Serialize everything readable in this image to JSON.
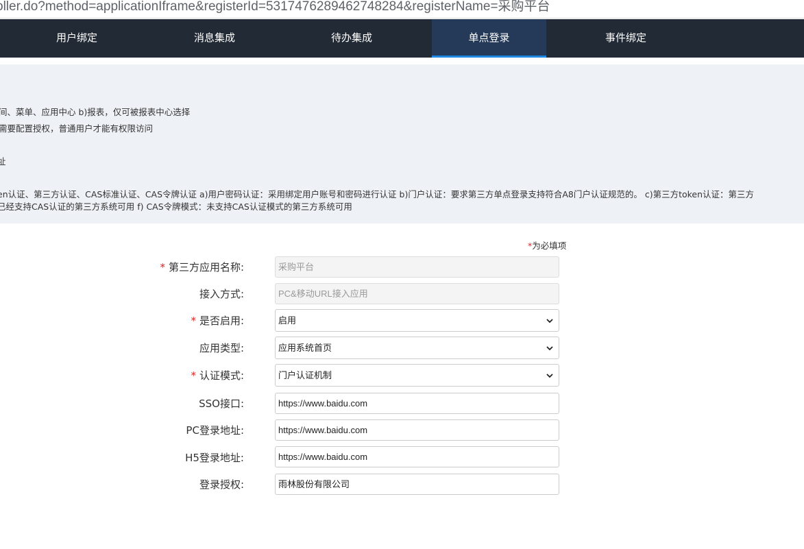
{
  "address_bar": {
    "url": "oller.do?method=applicationIframe&registerId=5317476289462748284&registerName=采购平台"
  },
  "tabs": [
    {
      "label": "用户绑定"
    },
    {
      "label": "消息集成"
    },
    {
      "label": "待办集成"
    },
    {
      "label": "单点登录",
      "active": true
    },
    {
      "label": "事件绑定"
    }
  ],
  "info": {
    "lines": [
      "间、菜单、应用中心 b)报表，仅可被报表中心选择",
      "需要配置授权，普通用户才能有权限访问",
      "址",
      "en认证、第三方认证、CAS标准认证、CAS令牌认证 a)用户密码认证：采用绑定用户账号和密码进行认证 b)门户认证：要求第三方单点登录支持符合A8门户认证规范的。 c)第三方token认证：第三方",
      "已经支持CAS认证的第三方系统可用 f) CAS令牌模式：未支持CAS认证模式的第三方系统可用"
    ]
  },
  "form": {
    "required_note": {
      "star": "*",
      "text": "为必填项"
    },
    "fields": [
      {
        "label": "第三方应用名称:",
        "required": true,
        "value": "采购平台"
      },
      {
        "label": "接入方式:",
        "required": false,
        "value": "PC&移动URL接入应用"
      },
      {
        "label": "是否启用:",
        "required": true,
        "value": "启用"
      },
      {
        "label": "应用类型:",
        "required": false,
        "value": "应用系统首页"
      },
      {
        "label": "认证模式:",
        "required": true,
        "value": "门户认证机制"
      },
      {
        "label": "SSO接口:",
        "required": false,
        "value": "https://www.baidu.com"
      },
      {
        "label": "PC登录地址:",
        "required": false,
        "value": "https://www.baidu.com"
      },
      {
        "label": "H5登录地址:",
        "required": false,
        "value": "https://www.baidu.com"
      },
      {
        "label": "登录授权:",
        "required": false,
        "value": "雨林股份有限公司"
      }
    ]
  },
  "icons": {
    "select_arrow": "chevron-down-icon"
  },
  "colors": {
    "nav_bg": "#222a35",
    "active_tab_bg": "#243a58",
    "active_tab_underline": "#1e88e5",
    "info_bg": "#eef2f6",
    "required_star": "#e02020"
  }
}
